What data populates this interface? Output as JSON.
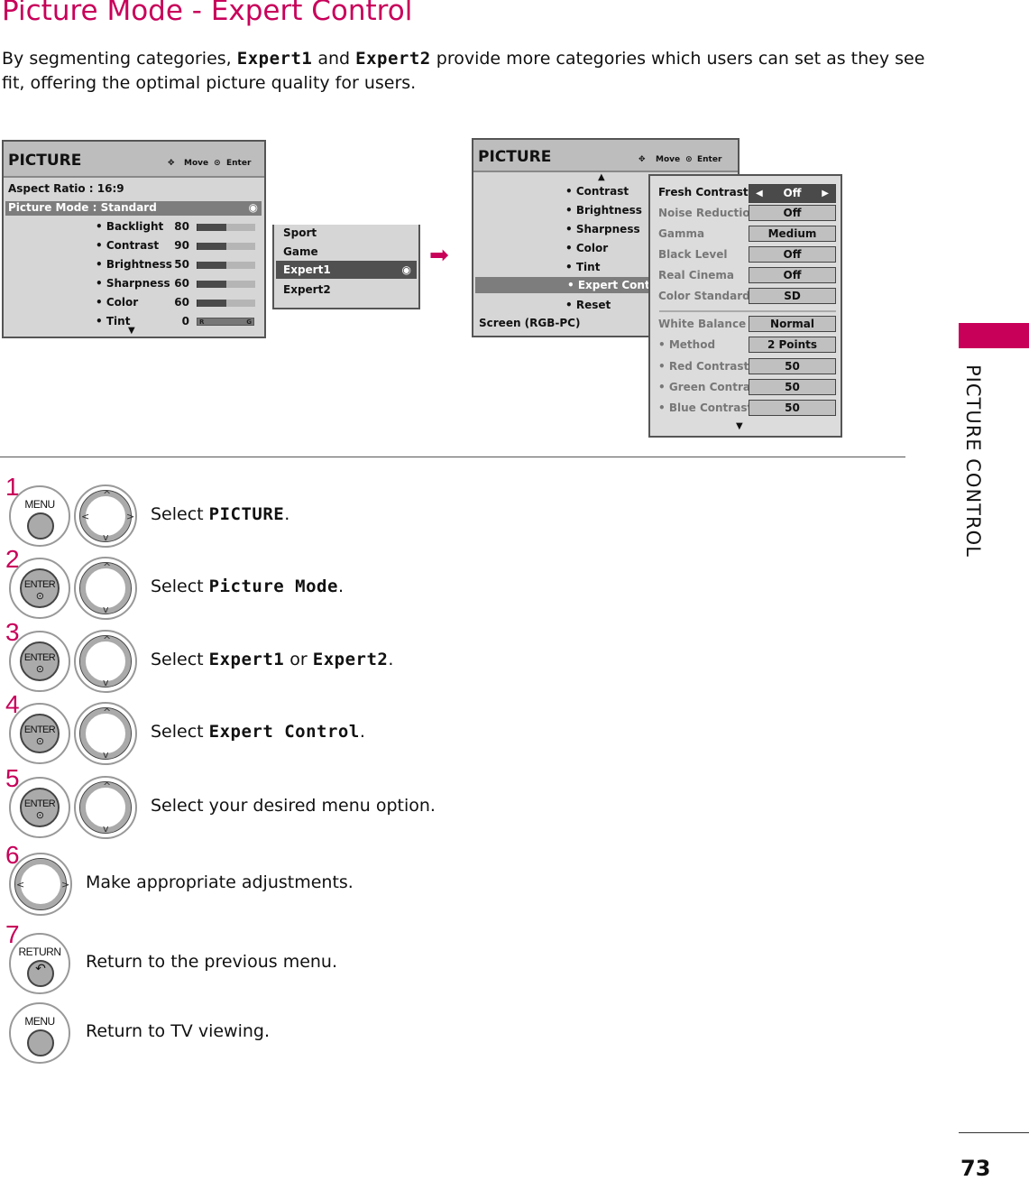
{
  "title": "Picture Mode - Expert Control",
  "intro": {
    "line1": [
      {
        "t": "By segmenting categories, "
      },
      {
        "t": "Expert1",
        "b": true
      },
      {
        "t": " and "
      },
      {
        "t": "Expert2",
        "b": true
      },
      {
        "t": " provide more categories which users can set as they see"
      }
    ],
    "line2": [
      {
        "t": "fit, offering the optimal picture quality for users."
      }
    ]
  },
  "menu1": {
    "title": "PICTURE",
    "move": "Move",
    "enter": "Enter",
    "aspect_ratio": "Aspect Ratio   : 16:9",
    "picture_mode": "Picture Mode  : Standard",
    "items": [
      {
        "label": "• Backlight",
        "value": "80",
        "level": 0.5
      },
      {
        "label": "• Contrast",
        "value": "90",
        "level": 0.5
      },
      {
        "label": "• Brightness",
        "value": "50",
        "level": 0.5
      },
      {
        "label": "• Sharpness",
        "value": "60",
        "level": 0.5
      },
      {
        "label": "• Color",
        "value": "60",
        "level": 0.5
      },
      {
        "label": "• Tint",
        "value": "0",
        "tint": [
          "R",
          "G"
        ]
      }
    ]
  },
  "submenu": {
    "items": [
      "Sport",
      "Game",
      "Expert1",
      "Expert2"
    ],
    "selected": "Expert1"
  },
  "menu2": {
    "title": "PICTURE",
    "move": "Move",
    "enter": "Enter",
    "items": [
      "• Contrast",
      "• Brightness",
      "• Sharpness",
      "• Color",
      "• Tint",
      "• Expert Contro",
      "• Reset"
    ],
    "selected": "• Expert Contro",
    "screen": "Screen (RGB-PC)"
  },
  "expert_panel": {
    "rows": [
      {
        "label": "Fresh Contrast",
        "value": "Off",
        "active": true
      },
      {
        "label": "Noise Reduction",
        "value": "Off"
      },
      {
        "label": "Gamma",
        "value": "Medium"
      },
      {
        "label": "Black Level",
        "value": "Off"
      },
      {
        "label": "Real Cinema",
        "value": "Off"
      },
      {
        "label": "Color Standard",
        "value": "SD"
      }
    ],
    "rows2": [
      {
        "label": "White Balance",
        "value": "Normal"
      },
      {
        "label": "• Method",
        "value": "2 Points"
      },
      {
        "label": "• Red Contrast",
        "value": "50"
      },
      {
        "label": "• Green Contrast",
        "value": "50"
      },
      {
        "label": "• Blue Contrast",
        "value": "50"
      }
    ]
  },
  "steps": [
    {
      "num": "1",
      "button": "MENU",
      "nav": "4way",
      "text": [
        {
          "t": "Select "
        },
        {
          "t": "PICTURE",
          "b": true
        },
        {
          "t": "."
        }
      ]
    },
    {
      "num": "2",
      "button": "ENTER",
      "nav": "updown",
      "text": [
        {
          "t": "Select "
        },
        {
          "t": "Picture Mode",
          "b": true
        },
        {
          "t": "."
        }
      ]
    },
    {
      "num": "3",
      "button": "ENTER",
      "nav": "updown",
      "text": [
        {
          "t": "Select "
        },
        {
          "t": "Expert1",
          "b": true
        },
        {
          "t": " or "
        },
        {
          "t": "Expert2",
          "b": true
        },
        {
          "t": "."
        }
      ]
    },
    {
      "num": "4",
      "button": "ENTER",
      "nav": "updown",
      "text": [
        {
          "t": "Select "
        },
        {
          "t": "Expert Control",
          "b": true
        },
        {
          "t": "."
        }
      ]
    },
    {
      "num": "5",
      "button": "ENTER",
      "nav": "updown",
      "text": [
        {
          "t": "Select your desired menu option."
        }
      ]
    },
    {
      "num": "6",
      "button": "",
      "nav": "leftright",
      "text": [
        {
          "t": "Make appropriate adjustments."
        }
      ]
    },
    {
      "num": "7",
      "button": "RETURN",
      "nav": "",
      "text": [
        {
          "t": "Return to the previous menu."
        }
      ]
    },
    {
      "num": "",
      "button": "MENU",
      "nav": "",
      "text": [
        {
          "t": "Return to TV viewing."
        }
      ]
    }
  ],
  "side_tab": "PICTURE CONTROL",
  "page_number": "73",
  "colors": {
    "accent": "#c8005a",
    "menu_bg": "#d6d6d6",
    "highlight": "#7d7d7d"
  }
}
